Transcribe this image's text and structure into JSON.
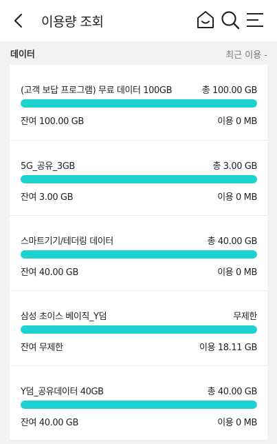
{
  "header": {
    "title": "이용량 조회",
    "back_icon": "chevron-left-icon",
    "home_icon": "home-icon",
    "search_icon": "search-icon",
    "menu_icon": "menu-icon"
  },
  "section": {
    "title": "데이터",
    "right_text": "최근 이용 -"
  },
  "plans": [
    {
      "name": "(고객 보답 프로그램) 무료 데이터 100GB",
      "total": "총 100.00 GB",
      "remaining": "잔여 100.00 GB",
      "used": "이용 0 MB",
      "remaining_fraction": 1.0
    },
    {
      "name": "5G_공유_3GB",
      "total": "총 3.00 GB",
      "remaining": "잔여 3.00 GB",
      "used": "이용 0 MB",
      "remaining_fraction": 1.0
    },
    {
      "name": "스마트기기/테더링 데이터",
      "total": "총 40.00 GB",
      "remaining": "잔여 40.00 GB",
      "used": "이용 0 MB",
      "remaining_fraction": 1.0
    },
    {
      "name": "삼성 초이스 베이직_Y덤",
      "total": "무제한",
      "remaining": "잔여 무제한",
      "used": "이용 18.11 GB",
      "remaining_fraction": 1.0
    },
    {
      "name": "Y덤_공유데이터 40GB",
      "total": "총 40.00 GB",
      "remaining": "잔여 40.00 GB",
      "used": "이용 0 MB",
      "remaining_fraction": 1.0
    }
  ],
  "colors": {
    "accent": "#1ed3cf",
    "track": "#e5e5e5",
    "background": "#f2f2f2"
  }
}
